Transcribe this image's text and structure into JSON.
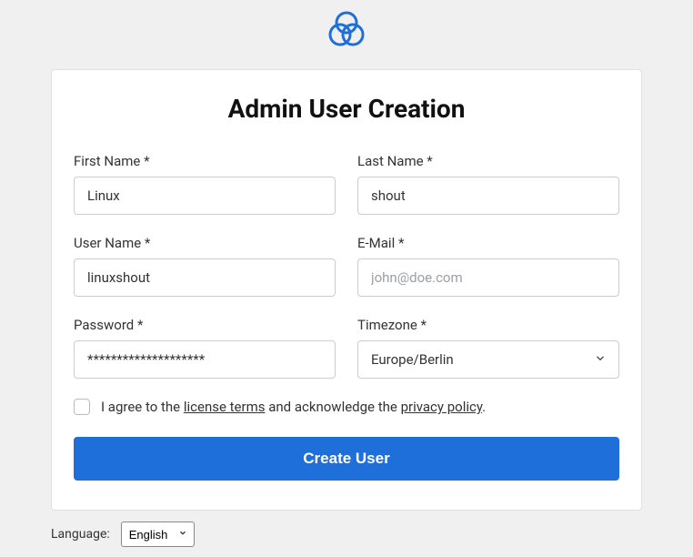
{
  "title": "Admin User Creation",
  "fields": {
    "first_name": {
      "label": "First Name *",
      "value": "Linux"
    },
    "last_name": {
      "label": "Last Name *",
      "value": "shout"
    },
    "user_name": {
      "label": "User Name *",
      "value": "linuxshout"
    },
    "email": {
      "label": "E-Mail *",
      "value": "",
      "placeholder": "john@doe.com"
    },
    "password": {
      "label": "Password *",
      "value": "********************"
    },
    "timezone": {
      "label": "Timezone *",
      "value": "Europe/Berlin"
    }
  },
  "agree": {
    "prefix": "I agree to the ",
    "license_link": "license terms",
    "middle": " and acknowledge the ",
    "privacy_link": "privacy policy",
    "suffix": "."
  },
  "submit_label": "Create User",
  "footer": {
    "language_label": "Language:",
    "language_value": "English"
  }
}
